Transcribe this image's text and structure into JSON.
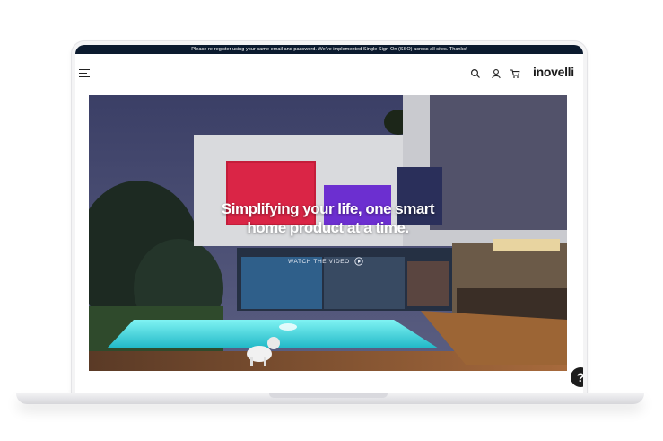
{
  "announcement": {
    "text": "Please re-register using your same email and password. We've implemented Single Sign-On (SSO) across all sites. Thanks!"
  },
  "header": {
    "logo_text": "inovelli",
    "icons": [
      "menu-icon",
      "search-icon",
      "user-icon",
      "cart-icon"
    ]
  },
  "hero": {
    "title_line1": "Simplifying your life, one smart",
    "title_line2": "home product at a time.",
    "watch_video_label": "WATCH THE VIDEO",
    "play_icon": "play-circle-icon"
  },
  "help": {
    "label": "?"
  },
  "colors": {
    "announcement_bg": "#0b1a2e",
    "pool": "#3fe0e6",
    "sky": "#3b3f66"
  }
}
